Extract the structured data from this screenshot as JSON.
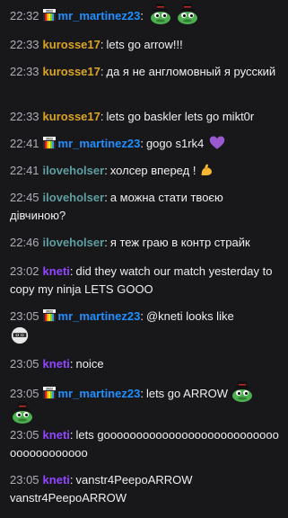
{
  "colors": {
    "background": "#18181b",
    "timestamp": "#adadb8",
    "text": "#efeff1",
    "mr_martinez23": "#1e90ff",
    "kurosse17": "#daa520",
    "iloveholser": "#5f9ea0",
    "kneti": "#9146ff"
  },
  "messages": [
    {
      "time": "22:32",
      "user": "mr_martinez23",
      "sep": ":",
      "text": "",
      "badge": "2022-badge",
      "emotes": [
        "peepo-tophat-emote",
        "peepo-tophat-emote"
      ]
    },
    {
      "time": "22:33",
      "user": "kurosse17",
      "sep": ":",
      "text": "lets go arrow!!!"
    },
    {
      "time": "22:33",
      "user": "kurosse17",
      "sep": ":",
      "text": "да я не англомовный я русский"
    },
    {
      "time": "22:33",
      "user": "kurosse17",
      "sep": ":",
      "text": "lets go baskler lets go mikt0r"
    },
    {
      "time": "22:41",
      "user": "mr_martinez23",
      "sep": ":",
      "text": "gogo s1rk4",
      "badge": "2022-badge",
      "emotes": [
        "purple-heart-emoji"
      ]
    },
    {
      "time": "22:41",
      "user": "iloveholser",
      "sep": ":",
      "text": "холсер вперед !",
      "emotes": [
        "flexed-bicep-emoji"
      ]
    },
    {
      "time": "22:45",
      "user": "iloveholser",
      "sep": ":",
      "text": "а можна стати твоєю дівчиною?"
    },
    {
      "time": "22:46",
      "user": "iloveholser",
      "sep": ":",
      "text": "я теж граю в контр страйк"
    },
    {
      "time": "23:02",
      "user": "kneti",
      "sep": ":",
      "text": "did they watch our match yesterday to copy my ninja LETS GOOO"
    },
    {
      "time": "23:05",
      "user": "mr_martinez23",
      "sep": ":",
      "text": "@kneti looks like",
      "badge": "2022-badge",
      "emotes": [
        "ninja-mask-emote"
      ]
    },
    {
      "time": "23:05",
      "user": "kneti",
      "sep": ":",
      "text": "noice"
    },
    {
      "time": "23:05",
      "user": "mr_martinez23",
      "sep": ":",
      "text": "lets go ARROW",
      "badge": "2022-badge",
      "emotes": [
        "peepo-tophat-emote",
        "peepo-tophat-emote"
      ]
    },
    {
      "time": "23:05",
      "user": "kneti",
      "sep": ":",
      "text": "lets gooooooooooooooooooooooooooooooooooooooo"
    },
    {
      "time": "23:05",
      "user": "kneti",
      "sep": ":",
      "text": "vanstr4PeepoARROW vanstr4PeepoARROW"
    }
  ]
}
